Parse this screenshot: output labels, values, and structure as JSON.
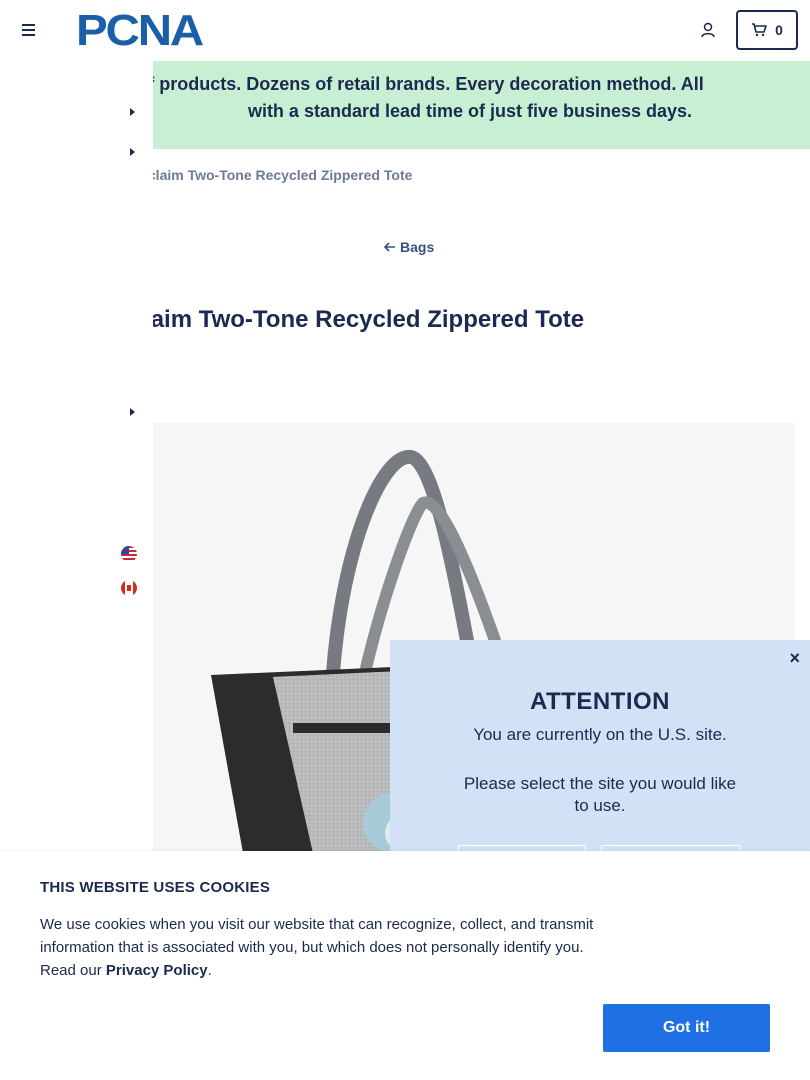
{
  "header": {
    "logo_text": "PCNA",
    "cart_count": "0"
  },
  "promo": {
    "line1": "Thousands of products. Dozens of retail brands. Every decoration method. All",
    "line2": "with a standard lead time of just five business days."
  },
  "breadcrumb": {
    "current": "Reclaim Two-Tone Recycled Zippered Tote"
  },
  "back_link": {
    "label": "Bags"
  },
  "product": {
    "title": "Reclaim Two-Tone Recycled Zippered Tote"
  },
  "site_popup": {
    "close_label": "×",
    "title": "ATTENTION",
    "line1": "You are currently on the U.S. site.",
    "line2": "Please select the site you would like to use."
  },
  "cookie_banner": {
    "title": "THIS WEBSITE USES COOKIES",
    "text": "We use cookies when you visit our website that can recognize, collect, and transmit information that is associated with you, but which does not personally identify you. Read our ",
    "link_label": "Privacy Policy",
    "text_end": ".",
    "button_label": "Got it!"
  },
  "colors": {
    "brand_blue": "#1a5fa8",
    "navy": "#1b2a4e",
    "promo_bg": "#c8efd4",
    "popup_bg": "#d3e1f6",
    "button_blue": "#1f6fe5"
  }
}
